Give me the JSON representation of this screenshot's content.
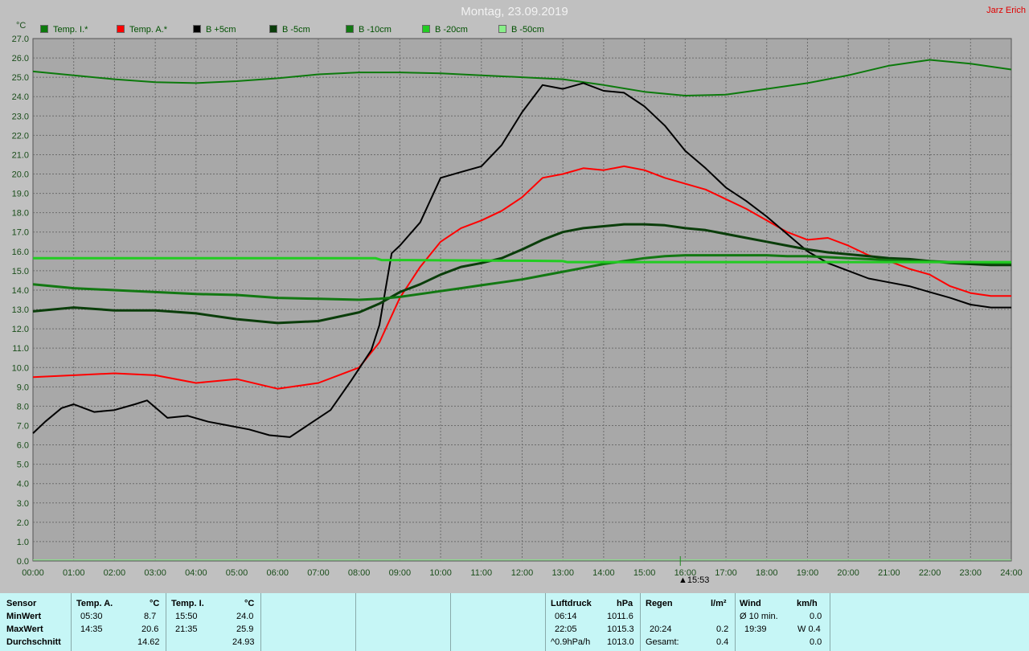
{
  "header": {
    "title": "Montag, 23.09.2019",
    "author": "Jarz Erich",
    "unit": "°C"
  },
  "legend": [
    {
      "label": "Temp. I.*",
      "color": "#0c7a0c"
    },
    {
      "label": "Temp. A.*",
      "color": "#ff0000"
    },
    {
      "label": "B +5cm",
      "color": "#000000"
    },
    {
      "label": "B -5cm",
      "color": "#0a3d0a"
    },
    {
      "label": "B -10cm",
      "color": "#127812"
    },
    {
      "label": "B -20cm",
      "color": "#22cc22"
    },
    {
      "label": "B -50cm",
      "color": "#88ee88"
    }
  ],
  "marker": {
    "label": "▲15:53",
    "time": 15.88
  },
  "chart_data": {
    "type": "line",
    "ylabel": "°C",
    "ylim": [
      0,
      27
    ],
    "xlim": [
      0,
      24
    ],
    "yticks": [
      "0.0",
      "1.0",
      "2.0",
      "3.0",
      "4.0",
      "5.0",
      "6.0",
      "7.0",
      "8.0",
      "9.0",
      "10.0",
      "11.0",
      "12.0",
      "13.0",
      "14.0",
      "15.0",
      "16.0",
      "17.0",
      "18.0",
      "19.0",
      "20.0",
      "21.0",
      "22.0",
      "23.0",
      "24.0",
      "25.0",
      "26.0",
      "27.0"
    ],
    "xticks": [
      "00:00",
      "01:00",
      "02:00",
      "03:00",
      "04:00",
      "05:00",
      "06:00",
      "07:00",
      "08:00",
      "09:00",
      "10:00",
      "11:00",
      "12:00",
      "13:00",
      "14:00",
      "15:00",
      "16:00",
      "17:00",
      "18:00",
      "19:00",
      "20:00",
      "21:00",
      "22:00",
      "23:00",
      "24:00"
    ],
    "grid": true,
    "series": [
      {
        "name": "Temp. I.*",
        "color": "#0c7a0c",
        "width": 2,
        "x": [
          0,
          1,
          2,
          3,
          4,
          5,
          6,
          7,
          8,
          9,
          10,
          11,
          12,
          13,
          14,
          15,
          16,
          17,
          18,
          19,
          20,
          21,
          22,
          23,
          24
        ],
        "y": [
          25.3,
          25.1,
          24.9,
          24.75,
          24.7,
          24.8,
          24.95,
          25.15,
          25.25,
          25.25,
          25.2,
          25.1,
          25.0,
          24.9,
          24.6,
          24.25,
          24.05,
          24.1,
          24.4,
          24.7,
          25.1,
          25.6,
          25.9,
          25.7,
          25.4
        ]
      },
      {
        "name": "Temp. A.*",
        "color": "#ff0000",
        "width": 2,
        "x": [
          0,
          1,
          2,
          3,
          4,
          5,
          6,
          7,
          7.5,
          8,
          8.5,
          9,
          9.5,
          10,
          10.5,
          11,
          11.5,
          12,
          12.5,
          13,
          13.5,
          14,
          14.5,
          15,
          15.5,
          16,
          16.5,
          17,
          17.5,
          18,
          18.5,
          19,
          19.5,
          20,
          20.5,
          21,
          21.5,
          22,
          22.5,
          23,
          23.5,
          24
        ],
        "y": [
          9.5,
          9.6,
          9.7,
          9.6,
          9.2,
          9.4,
          8.9,
          9.2,
          9.6,
          10.0,
          11.3,
          13.6,
          15.2,
          16.5,
          17.2,
          17.6,
          18.1,
          18.8,
          19.8,
          20.0,
          20.3,
          20.2,
          20.4,
          20.2,
          19.8,
          19.5,
          19.2,
          18.7,
          18.2,
          17.6,
          17.0,
          16.6,
          16.7,
          16.3,
          15.8,
          15.5,
          15.1,
          14.8,
          14.2,
          13.85,
          13.7,
          13.7
        ]
      },
      {
        "name": "B +5cm",
        "color": "#000000",
        "width": 2,
        "x": [
          0,
          0.3,
          0.7,
          1,
          1.5,
          2,
          2.5,
          2.8,
          3.3,
          3.8,
          4.3,
          4.8,
          5.3,
          5.8,
          6.3,
          6.8,
          7.3,
          7.8,
          8.3,
          8.5,
          8.8,
          9,
          9.5,
          10,
          10.5,
          11,
          11.5,
          12,
          12.5,
          13,
          13.5,
          14,
          14.5,
          15,
          15.5,
          16,
          16.5,
          17,
          17.5,
          18,
          18.5,
          19,
          19.5,
          20,
          20.5,
          21,
          21.5,
          22,
          22.5,
          23,
          23.5,
          24
        ],
        "y": [
          6.6,
          7.2,
          7.9,
          8.1,
          7.7,
          7.8,
          8.1,
          8.3,
          7.4,
          7.5,
          7.2,
          7.0,
          6.8,
          6.5,
          6.4,
          7.1,
          7.8,
          9.3,
          10.9,
          12.2,
          15.9,
          16.3,
          17.5,
          19.8,
          20.1,
          20.4,
          21.5,
          23.2,
          24.6,
          24.4,
          24.7,
          24.3,
          24.2,
          23.5,
          22.5,
          21.2,
          20.3,
          19.3,
          18.6,
          17.8,
          16.9,
          16.0,
          15.4,
          15.0,
          14.6,
          14.4,
          14.2,
          13.9,
          13.6,
          13.25,
          13.1,
          13.1
        ]
      },
      {
        "name": "B -5cm",
        "color": "#0a3d0a",
        "width": 3,
        "x": [
          0,
          1,
          2,
          3,
          4,
          5,
          6,
          7,
          8,
          8.5,
          9,
          9.5,
          10,
          10.5,
          11,
          11.5,
          12,
          12.5,
          13,
          13.5,
          14,
          14.5,
          15,
          15.5,
          16,
          16.5,
          17,
          17.5,
          18,
          18.5,
          19,
          19.5,
          20,
          20.5,
          21,
          21.5,
          22,
          22.5,
          23,
          23.5,
          24
        ],
        "y": [
          12.9,
          13.1,
          12.95,
          12.95,
          12.8,
          12.5,
          12.3,
          12.4,
          12.85,
          13.3,
          13.9,
          14.3,
          14.8,
          15.2,
          15.4,
          15.65,
          16.1,
          16.6,
          17.0,
          17.2,
          17.3,
          17.4,
          17.4,
          17.35,
          17.2,
          17.1,
          16.9,
          16.7,
          16.5,
          16.3,
          16.1,
          15.95,
          15.85,
          15.75,
          15.65,
          15.6,
          15.5,
          15.4,
          15.35,
          15.3,
          15.3
        ]
      },
      {
        "name": "B -10cm",
        "color": "#127812",
        "width": 3,
        "x": [
          0,
          1,
          2,
          3,
          4,
          5,
          6,
          7,
          8,
          8.5,
          9,
          9.5,
          10,
          10.5,
          11,
          11.5,
          12,
          12.5,
          13,
          13.5,
          14,
          14.5,
          15,
          15.5,
          16,
          16.5,
          17,
          17.5,
          18,
          18.5,
          19,
          19.5,
          20,
          20.5,
          21,
          21.5,
          22,
          22.5,
          23,
          23.5,
          24
        ],
        "y": [
          14.3,
          14.1,
          14.0,
          13.9,
          13.8,
          13.75,
          13.6,
          13.55,
          13.5,
          13.55,
          13.65,
          13.8,
          13.95,
          14.1,
          14.25,
          14.4,
          14.55,
          14.75,
          14.95,
          15.15,
          15.35,
          15.5,
          15.65,
          15.75,
          15.8,
          15.8,
          15.8,
          15.8,
          15.8,
          15.75,
          15.75,
          15.7,
          15.65,
          15.6,
          15.55,
          15.5,
          15.5,
          15.45,
          15.45,
          15.4,
          15.4
        ]
      },
      {
        "name": "B -20cm",
        "color": "#22cc22",
        "width": 3,
        "x": [
          0,
          4,
          8,
          8.4,
          8.55,
          9,
          12,
          13,
          13.1,
          14,
          16,
          18,
          20,
          24
        ],
        "y": [
          15.65,
          15.65,
          15.65,
          15.65,
          15.55,
          15.55,
          15.52,
          15.5,
          15.45,
          15.45,
          15.45,
          15.45,
          15.45,
          15.45
        ]
      },
      {
        "name": "B -50cm",
        "color": "#88ee88",
        "width": 1,
        "x": [
          0,
          24
        ],
        "y": [
          0.05,
          0.05
        ]
      }
    ]
  },
  "stats": {
    "sensor_label": "Sensor",
    "row_labels": [
      "MinWert",
      "MaxWert",
      "Durchschnitt"
    ],
    "temp_a": {
      "title": "Temp. A.",
      "unit": "°C",
      "min_time": "05:30",
      "min_val": "8.7",
      "max_time": "14:35",
      "max_val": "20.6",
      "avg": "14.62"
    },
    "temp_i": {
      "title": "Temp. I.",
      "unit": "°C",
      "min_time": "15:50",
      "min_val": "24.0",
      "max_time": "21:35",
      "max_val": "25.9",
      "avg": "24.93"
    },
    "pressure": {
      "title": "Luftdruck",
      "unit": "hPa",
      "min_time": "06:14",
      "min_val": "1011.6",
      "max_time": "22:05",
      "max_val": "1015.3",
      "trend_label": "^0.9hPa/h",
      "trend_val": "1013.0"
    },
    "rain": {
      "title": "Regen",
      "unit": "l/m²",
      "max_time": "20:24",
      "max_val": "0.2",
      "total_label": "Gesamt:",
      "total_val": "0.4"
    },
    "wind": {
      "title": "Wind",
      "unit": "km/h",
      "avg_label": "Ø 10 min.",
      "avg_val": "0.0",
      "max_time": "19:39",
      "max_val": "W 0.4",
      "third_val": "0.0"
    }
  }
}
